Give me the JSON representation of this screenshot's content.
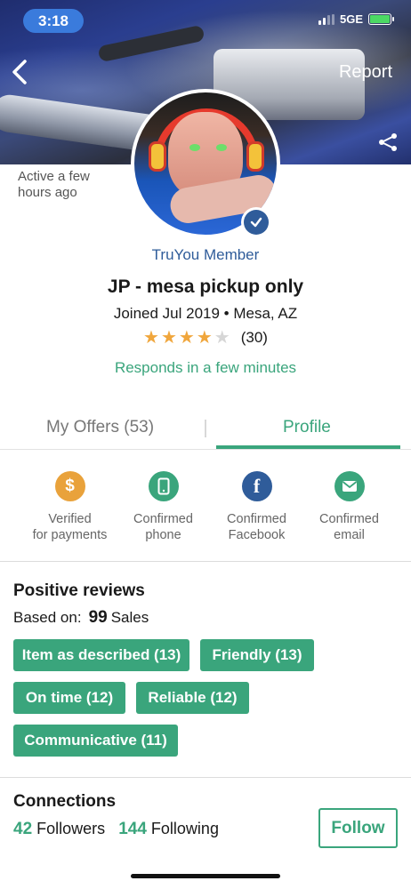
{
  "status": {
    "time": "3:18",
    "network": "5GE"
  },
  "header": {
    "back_icon": "chevron-left-icon",
    "report_label": "Report",
    "share_icon": "share-icon"
  },
  "profile": {
    "active_status": "Active a few hours ago",
    "member_label": "TruYou Member",
    "name": "JP - mesa pickup only",
    "joined": "Joined Jul 2019 • Mesa, AZ",
    "rating_stars": 4,
    "rating_count": "(30)",
    "responds": "Responds in a few minutes"
  },
  "tabs": {
    "offers": "My Offers (53)",
    "profile": "Profile",
    "active": "profile"
  },
  "verifications": [
    {
      "label": "Verified for payments",
      "icon": "dollar-icon",
      "color": "#e9a23b"
    },
    {
      "label": "Confirmed phone",
      "icon": "phone-icon",
      "color": "#3aa57c"
    },
    {
      "label": "Confirmed Facebook",
      "icon": "facebook-icon",
      "color": "#2f5c9a"
    },
    {
      "label": "Confirmed email",
      "icon": "email-icon",
      "color": "#3aa57c"
    }
  ],
  "reviews": {
    "title": "Positive reviews",
    "based_on_label": "Based on:",
    "sales_count": "99",
    "sales_label": "Sales",
    "tags": [
      "Item as described (13)",
      "Friendly (13)",
      "On time (12)",
      "Reliable (12)",
      "Communicative (11)"
    ]
  },
  "connections": {
    "title": "Connections",
    "followers_count": "42",
    "followers_label": "Followers",
    "following_count": "144",
    "following_label": "Following",
    "follow_button": "Follow"
  },
  "colors": {
    "accent": "#3aa57c",
    "brand_blue": "#2f5c9a",
    "star": "#f0a63c"
  }
}
